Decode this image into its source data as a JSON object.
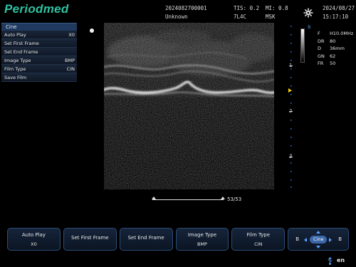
{
  "header": {
    "brand": "Periodmed",
    "patient_id": "2024082700001",
    "patient_name": "Unknown",
    "tis": "TIS: 0.2",
    "mi": "MI: 0.8",
    "probe": "7L4C",
    "preset": "MSK",
    "date": "2024/08/27",
    "time": "15:17:10",
    "settings_icon": "gear-icon"
  },
  "cine_menu": {
    "title": "Cine",
    "items": [
      {
        "label": "Auto Play",
        "value": "X0"
      },
      {
        "label": "Set First Frame",
        "value": ""
      },
      {
        "label": "Set End Frame",
        "value": ""
      },
      {
        "label": "Image Type",
        "value": "BMP"
      },
      {
        "label": "Film Type",
        "value": "CIN"
      },
      {
        "label": "Save Film",
        "value": ""
      }
    ]
  },
  "mode_indicator": "B",
  "params": [
    {
      "key": "F",
      "value": "H10.0MHz"
    },
    {
      "key": "DR",
      "value": "80"
    },
    {
      "key": "D",
      "value": "36mm"
    },
    {
      "key": "GN",
      "value": "62"
    },
    {
      "key": "FR",
      "value": "50"
    }
  ],
  "depth_scale": {
    "labels": [
      "1",
      "2",
      "3"
    ]
  },
  "cine_frames": {
    "current": 53,
    "total": 53,
    "display": "53/53"
  },
  "softkeys": [
    {
      "label": "Auto Play",
      "value": "X0"
    },
    {
      "label": "Set First Frame",
      "value": ""
    },
    {
      "label": "Set End Frame",
      "value": ""
    },
    {
      "label": "Image Type",
      "value": "BMP"
    },
    {
      "label": "Film Type",
      "value": "CIN"
    }
  ],
  "cine_nav": {
    "left": "B",
    "center": "Cine",
    "right": "B"
  },
  "status": {
    "language": "en",
    "usb_icon": "usb-icon"
  },
  "colors": {
    "brand": "#2fc3a3",
    "accent": "#3b68a8",
    "marker": "#f0d000"
  }
}
